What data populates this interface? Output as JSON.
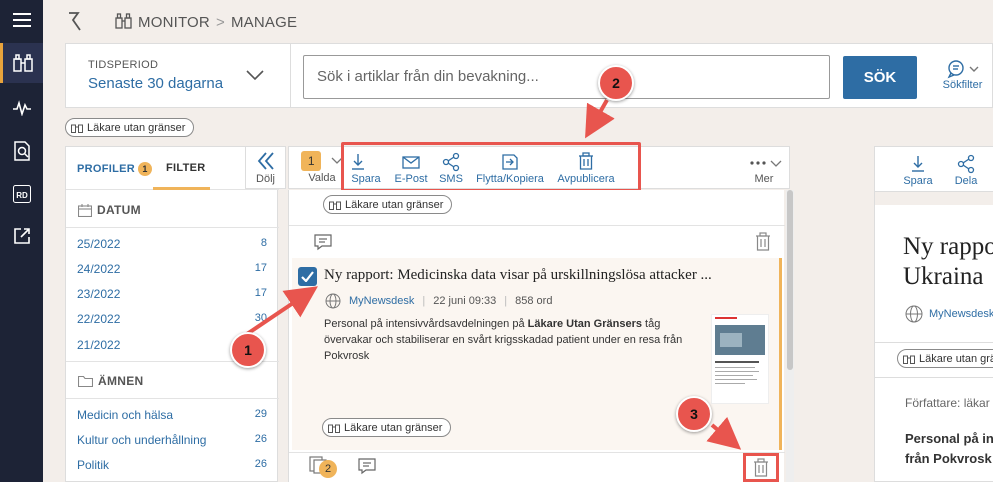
{
  "breadcrumb": {
    "root": "MONITOR",
    "separator": ">",
    "current": "MANAGE"
  },
  "search": {
    "period_label": "TIDSPERIOD",
    "period_value": "Senaste 30 dagarna",
    "placeholder": "Sök i artiklar från din bevakning...",
    "button": "SÖK",
    "filter_label": "Sökfilter"
  },
  "active_chip": "Läkare utan gränser",
  "left_panel": {
    "tab_profiles": "PROFILER",
    "profiles_badge": "1",
    "tab_filter": "FILTER",
    "hide_label": "Dölj",
    "section_date": "DATUM",
    "dates": [
      {
        "label": "25/2022",
        "count": "8"
      },
      {
        "label": "24/2022",
        "count": "17"
      },
      {
        "label": "23/2022",
        "count": "17"
      },
      {
        "label": "22/2022",
        "count": "30"
      },
      {
        "label": "21/2022",
        "count": ""
      }
    ],
    "section_topics": "ÄMNEN",
    "topics": [
      {
        "label": "Medicin och hälsa",
        "count": "29"
      },
      {
        "label": "Kultur och underhållning",
        "count": "26"
      },
      {
        "label": "Politik",
        "count": "26"
      }
    ]
  },
  "toolbar": {
    "selected_count": "1",
    "selected_label": "Valda",
    "actions": [
      "Spara",
      "E-Post",
      "SMS",
      "Flytta/Kopiera",
      "Avpublicera"
    ],
    "more_label": "Mer"
  },
  "list": {
    "chip_top": "Läkare utan gränser",
    "article": {
      "title": "Ny rapport: Medicinska data visar på urskillningslösa attacker ...",
      "source": "MyNewsdesk",
      "date": "22 juni 09:33",
      "words": "858 ord",
      "body_pre": "Personal på intensivvårdsavdelningen på ",
      "body_bold": "Läkare Utan Gränsers",
      "body_post": " tåg övervakar och stabiliserar en svårt krigsskadad patient under en resa från Pokvrosk",
      "chip": "Läkare utan gränser",
      "copies_badge": "2"
    }
  },
  "preview": {
    "actions": [
      "Spara",
      "Dela"
    ],
    "title_line1": "Ny rappo",
    "title_line2": "Ukraina",
    "source": "MyNewsdesk",
    "chip": "Läkare utan gränser",
    "author_label": "Författare: läkar",
    "lead_line1": "Personal på in",
    "lead_line2": "från Pokvrosk"
  },
  "annotations": [
    "1",
    "2",
    "3"
  ],
  "colors": {
    "rail": "#1d2336",
    "accent": "#2e6da4",
    "highlight": "#e8554e",
    "badge": "#f0b45a"
  }
}
